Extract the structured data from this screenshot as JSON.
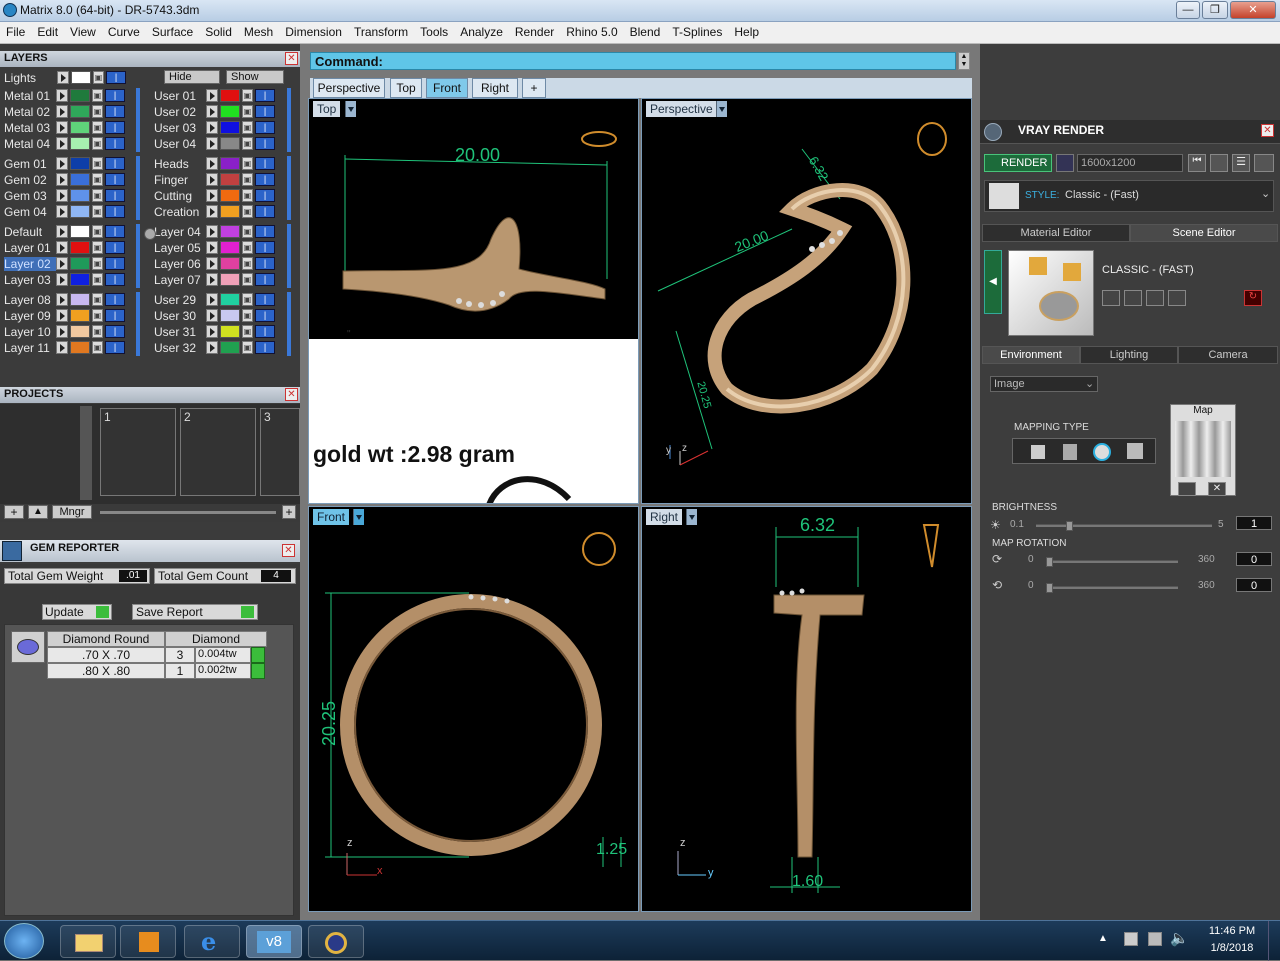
{
  "window": {
    "title": "Matrix 8.0 (64-bit) - DR-5743.3dm",
    "min": "—",
    "max": "❐",
    "close": "✕"
  },
  "menu": [
    "File",
    "Edit",
    "View",
    "Curve",
    "Surface",
    "Solid",
    "Mesh",
    "Dimension",
    "Transform",
    "Tools",
    "Analyze",
    "Render",
    "Rhino 5.0",
    "Blend",
    "T-Splines",
    "Help"
  ],
  "layers": {
    "title": "LAYERS",
    "lights": "Lights",
    "hide": "Hide",
    "show": "Show",
    "left_groups": [
      [
        {
          "name": "Metal 01",
          "color": "#1f7a3c"
        },
        {
          "name": "Metal 02",
          "color": "#2fa75a"
        },
        {
          "name": "Metal 03",
          "color": "#5fd37a"
        },
        {
          "name": "Metal 04",
          "color": "#a6f0b0"
        }
      ],
      [
        {
          "name": "Gem 01",
          "color": "#0e3ea8"
        },
        {
          "name": "Gem 02",
          "color": "#3a6fd8"
        },
        {
          "name": "Gem 03",
          "color": "#5f92ea"
        },
        {
          "name": "Gem 04",
          "color": "#8fb6f4"
        }
      ],
      [
        {
          "name": "Default",
          "color": "#ffffff"
        },
        {
          "name": "Layer 01",
          "color": "#e01010"
        },
        {
          "name": "Layer 02",
          "color": "#1f9a5a",
          "selected": true
        },
        {
          "name": "Layer 03",
          "color": "#1020e0"
        }
      ],
      [
        {
          "name": "Layer 08",
          "color": "#c8b8f0"
        },
        {
          "name": "Layer 09",
          "color": "#f0a020"
        },
        {
          "name": "Layer 10",
          "color": "#f0c8a0"
        },
        {
          "name": "Layer 11",
          "color": "#e07820"
        }
      ]
    ],
    "right_groups": [
      [
        {
          "name": "User 01",
          "color": "#e01010"
        },
        {
          "name": "User 02",
          "color": "#20e020"
        },
        {
          "name": "User 03",
          "color": "#1010e0"
        },
        {
          "name": "User 04",
          "color": "#888888"
        }
      ],
      [
        {
          "name": "Heads",
          "color": "#8a20c8"
        },
        {
          "name": "Finger",
          "color": "#c04040"
        },
        {
          "name": "Cutting",
          "color": "#f06a10"
        },
        {
          "name": "Creation",
          "color": "#f0a020"
        }
      ],
      [
        {
          "name": "Layer 04",
          "color": "#c040e0"
        },
        {
          "name": "Layer 05",
          "color": "#e020d0"
        },
        {
          "name": "Layer 06",
          "color": "#e040a0"
        },
        {
          "name": "Layer 07",
          "color": "#f0a0b8"
        }
      ],
      [
        {
          "name": "User 29",
          "color": "#20d0a0"
        },
        {
          "name": "User 30",
          "color": "#c8c8f0"
        },
        {
          "name": "User 31",
          "color": "#d0e020"
        },
        {
          "name": "User 32",
          "color": "#20a050"
        }
      ]
    ]
  },
  "projects": {
    "title": "PROJECTS",
    "slots": [
      "1",
      "2",
      "3"
    ],
    "mngr": "Mngr",
    "plus": "+"
  },
  "gem": {
    "title": "GEM REPORTER",
    "weight_label": "Total Gem Weight",
    "weight": ".01",
    "count_label": "Total Gem Count",
    "count": "4",
    "update": "Update",
    "save": "Save Report",
    "headers": [
      "Diamond Round",
      "Diamond"
    ],
    "rows": [
      {
        "size": ".70 X .70",
        "qty": "3",
        "tw": "0.004tw"
      },
      {
        "size": ".80 X .80",
        "qty": "1",
        "tw": "0.002tw"
      }
    ]
  },
  "command": {
    "label": "Command:"
  },
  "view_tabs": [
    "Perspective",
    "Top",
    "Front",
    "Right",
    "+"
  ],
  "viewports": {
    "top": "Top",
    "perspective": "Perspective",
    "front": "Front",
    "right": "Right"
  },
  "dims": {
    "top_w": "20.00",
    "persp_a": "6.32",
    "persp_b": "20.00",
    "persp_c": "20.25",
    "front_h": "20.25",
    "front_t": "1.25",
    "right_w": "6.32",
    "right_t": "1.60"
  },
  "note": {
    "text": "gold wt :2.98 gram",
    "mark": "\""
  },
  "axes": {
    "z": "z",
    "x": "x",
    "y": "y"
  },
  "vray": {
    "title": "VRAY RENDER",
    "render": "RENDER",
    "resolution": "1600x1200",
    "style_label": "STYLE:",
    "style_value": "Classic - (Fast)",
    "tabs": [
      "Material Editor",
      "Scene Editor"
    ],
    "preset": "CLASSIC - (FAST)",
    "env_tabs": [
      "Environment",
      "Lighting",
      "Camera"
    ],
    "mode": "Image",
    "mapping": "MAPPING TYPE",
    "map": "Map",
    "brightness": {
      "label": "BRIGHTNESS",
      "min": "0.1",
      "max": "5",
      "value": "1",
      "level": 0.18
    },
    "rotation": {
      "label": "MAP ROTATION",
      "min": "0",
      "max": "360",
      "value": "0",
      "min2": "0",
      "max2": "360",
      "value2": "0"
    }
  },
  "taskbar": {
    "time": "11:46 PM",
    "date": "1/8/2018",
    "v8": "v8"
  }
}
